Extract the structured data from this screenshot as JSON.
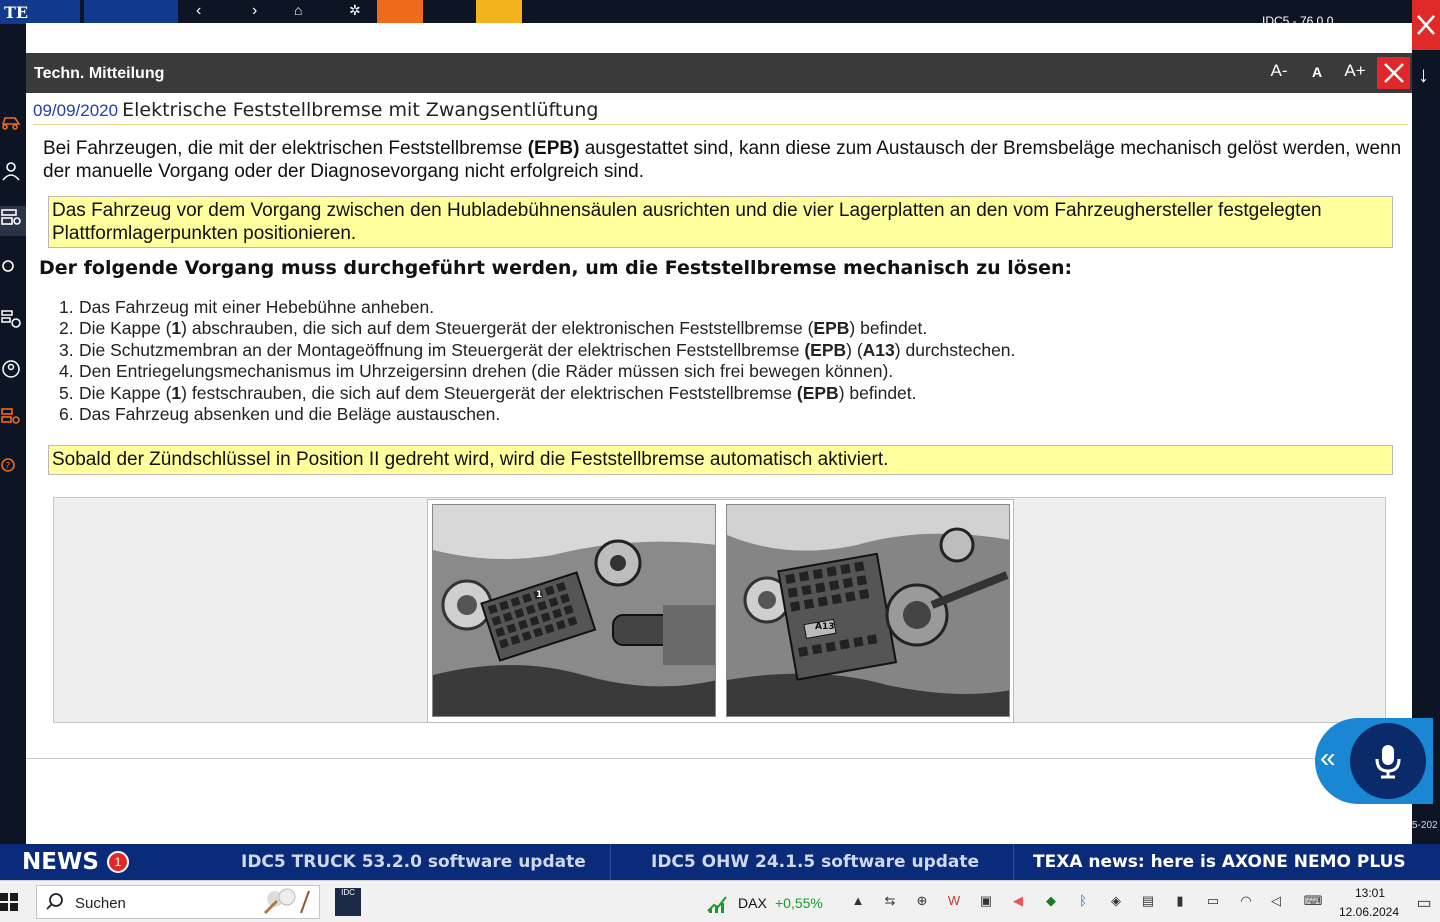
{
  "app": {
    "logo_text": "TE",
    "version_text": "IDC5 - 76.0.0"
  },
  "dialog": {
    "title": "Techn. Mitteilung",
    "font_decrease": "A-",
    "font_reset": "A",
    "font_increase": "A+"
  },
  "document": {
    "date": "09/09/2020",
    "title": "Elektrische Feststellbremse mit Zwangsentlüftung",
    "intro_before": "Bei Fahrzeugen, die mit der elektrischen Feststellbremse ",
    "intro_bold": "(EPB)",
    "intro_after": " ausgestattet sind, kann diese zum Austausch der Bremsbeläge mechanisch gelöst werden, wenn der manuelle Vorgang oder der Diagnosevorgang nicht erfolgreich sind.",
    "note1": "Das Fahrzeug vor dem Vorgang zwischen den Hubladebühnensäulen ausrichten und die vier Lagerplatten an den vom Fahrzeughersteller festgelegten Plattformlagerpunkten positionieren.",
    "section_title": "Der folgende Vorgang muss durchgeführt werden, um die Feststellbremse mechanisch zu lösen:",
    "steps": [
      {
        "num": "1.",
        "parts": [
          {
            "t": "Das Fahrzeug mit einer Hebebühne anheben.",
            "b": false
          }
        ]
      },
      {
        "num": "2.",
        "parts": [
          {
            "t": "Die Kappe (",
            "b": false
          },
          {
            "t": "1",
            "b": true
          },
          {
            "t": ") abschrauben, die sich auf dem Steuergerät der elektronischen Feststellbremse (",
            "b": false
          },
          {
            "t": "EPB",
            "b": true
          },
          {
            "t": ") befindet.",
            "b": false
          }
        ]
      },
      {
        "num": "3.",
        "parts": [
          {
            "t": "Die Schutzmembran an der Montageöffnung im Steuergerät der elektrischen Feststellbremse ",
            "b": false
          },
          {
            "t": "(EPB",
            "b": true
          },
          {
            "t": ") (",
            "b": false
          },
          {
            "t": "A13",
            "b": true
          },
          {
            "t": ") durchstechen.",
            "b": false
          }
        ]
      },
      {
        "num": "4.",
        "parts": [
          {
            "t": "Den Entriegelungsmechanismus im Uhrzeigersinn drehen (die Räder müssen sich frei bewegen können).",
            "b": false
          }
        ]
      },
      {
        "num": "5.",
        "parts": [
          {
            "t": "Die Kappe (",
            "b": false
          },
          {
            "t": "1",
            "b": true
          },
          {
            "t": ") festschrauben, die sich auf dem Steuergerät der elektrischen Feststellbremse ",
            "b": false
          },
          {
            "t": "(EPB",
            "b": true
          },
          {
            "t": ") befindet.",
            "b": false
          }
        ]
      },
      {
        "num": "6.",
        "parts": [
          {
            "t": "Das Fahrzeug absenken und die Beläge austauschen.",
            "b": false
          }
        ]
      }
    ],
    "note2": "Sobald der Zündschlüssel in Position II gedreht wird, wird die Feststellbremse automatisch aktiviert.",
    "photo1_label": "1",
    "photo2_label": "A13"
  },
  "news": {
    "label": "NEWS",
    "badge_count": "1",
    "items": [
      "IDC5 TRUCK 53.2.0 software update",
      "IDC5 OHW 24.1.5 software update",
      "TEXA news: here is AXONE NEMO PLUS"
    ],
    "partial": "5-202"
  },
  "taskbar": {
    "search_label": "Suchen",
    "idc_label": "IDC",
    "dax_label": "DAX",
    "dax_value": "+0,55%",
    "time": "13:01",
    "date": "12.06.2024"
  },
  "colors": {
    "accent_blue": "#0a2a7a",
    "close_red": "#e0282b",
    "note_yellow": "#ffff9e",
    "mic_blue": "#1a87d4"
  }
}
